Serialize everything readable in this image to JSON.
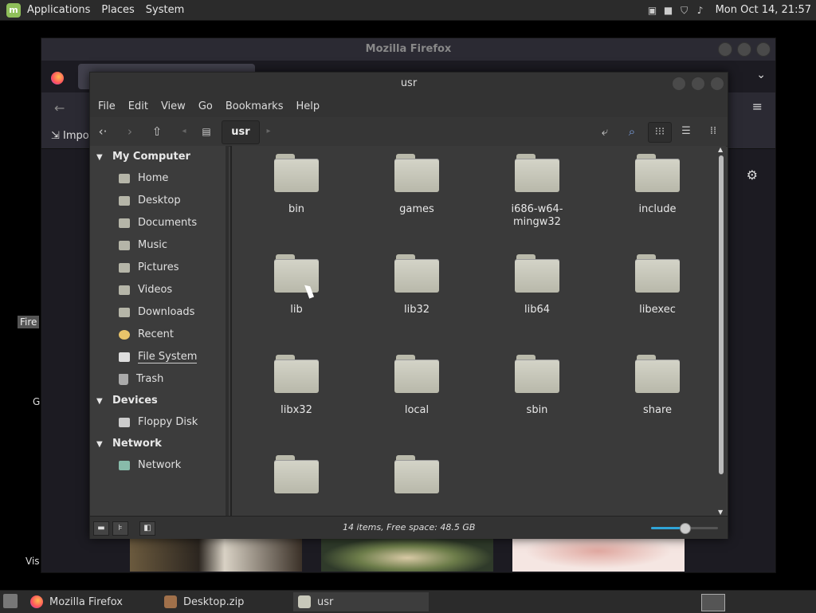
{
  "top_panel": {
    "menus": [
      "Applications",
      "Places",
      "System"
    ],
    "clock": "Mon Oct 14, 21:57"
  },
  "firefox": {
    "title": "Mozilla Firefox",
    "bookmarks_import": "Impo",
    "side_fire": "Fire",
    "side_g": "G",
    "side_vis": "Vis"
  },
  "nemo": {
    "title": "usr",
    "menus": [
      "File",
      "Edit",
      "View",
      "Go",
      "Bookmarks",
      "Help"
    ],
    "path_current": "usr",
    "sidebar": {
      "sections": [
        {
          "label": "My Computer",
          "items": [
            "Home",
            "Desktop",
            "Documents",
            "Music",
            "Pictures",
            "Videos",
            "Downloads",
            "Recent",
            "File System",
            "Trash"
          ]
        },
        {
          "label": "Devices",
          "items": [
            "Floppy Disk"
          ]
        },
        {
          "label": "Network",
          "items": [
            "Network"
          ]
        }
      ]
    },
    "folders": [
      "bin",
      "games",
      "i686-w64-mingw32",
      "include",
      "lib",
      "lib32",
      "lib64",
      "libexec",
      "libx32",
      "local",
      "sbin",
      "share",
      "",
      ""
    ],
    "status": "14 items, Free space: 48.5 GB",
    "zoom_level": 0.5
  },
  "taskbar": {
    "tasks": [
      "Mozilla Firefox",
      "Desktop.zip",
      "usr"
    ]
  },
  "colors": {
    "accent": "#2fa4d7",
    "folder": "#c8c8ba"
  }
}
